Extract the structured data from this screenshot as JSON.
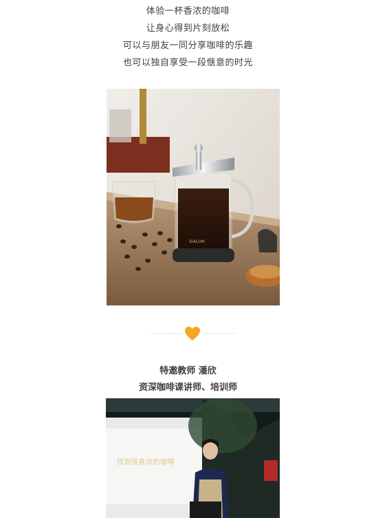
{
  "intro": {
    "lines": [
      "体验一杯香浓的咖啡",
      "让身心得到片刻放松",
      "可以与朋友一同分享咖啡的乐趣",
      "也可以独自享受一段惬意的时光"
    ]
  },
  "photo_1": {
    "kettle_brand": "SIALOM"
  },
  "divider": {
    "icon": "heart-icon",
    "color": "#f5a623"
  },
  "teacher": {
    "name": "特邀教师 潘欣",
    "title": "资深咖啡课讲师、培训师"
  },
  "photo_2": {
    "screen_text": "找到我喜欢的咖啡"
  }
}
